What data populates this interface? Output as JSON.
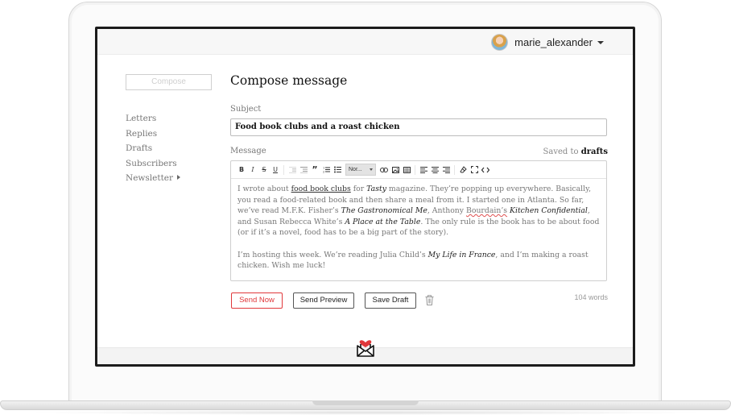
{
  "user": {
    "name": "marie_alexander",
    "avatar_icon": "user-avatar"
  },
  "sidebar": {
    "compose_label": "Compose",
    "items": [
      {
        "label": "Letters"
      },
      {
        "label": "Replies"
      },
      {
        "label": "Drafts"
      },
      {
        "label": "Subscribers"
      },
      {
        "label": "Newsletter",
        "has_submenu": true
      }
    ]
  },
  "main": {
    "title": "Compose message",
    "subject_label": "Subject",
    "subject_value": "Food book clubs and a roast chicken",
    "message_label": "Message",
    "saved_prefix": "Saved to",
    "saved_location": "drafts"
  },
  "toolbar": {
    "format_select": "Nor...",
    "buttons": [
      "bold-icon",
      "italic-icon",
      "strikethrough-icon",
      "underline-icon",
      "outdent-icon",
      "indent-icon",
      "blockquote-icon",
      "ordered-list-icon",
      "bullet-list-icon",
      "link-icon",
      "image-icon",
      "table-icon",
      "align-left-icon",
      "align-center-icon",
      "align-right-icon",
      "clear-format-icon",
      "fullscreen-icon",
      "code-view-icon"
    ]
  },
  "message": {
    "p1": {
      "t1": "I wrote about ",
      "link1": "food book clubs",
      "t2": " for ",
      "em1": "Tasty",
      "t3": " magazine. They’re popping up everywhere. Basically, you read a food-related book and then share a meal from it. I started one in Atlanta. So far, we’ve read M.F.K. Fisher’s ",
      "em2": "The Gastronomical Me",
      "t4": ", Anthony ",
      "spell1": "Bourdain’s",
      "t5": " ",
      "em3": "Kitchen Confidential",
      "t6": ", and Susan Rebecca White’s ",
      "em4": "A Place at the Table",
      "t7": ". The only rule is the book has to be about food (or if it’s a novel, food has to be a big part of the story)."
    },
    "p2": {
      "t1": "I’m hosting this week. We’re reading Julia Child’s ",
      "em1": "My Life in France",
      "t2": ", and I’m making a roast chicken. Wish me luck!"
    }
  },
  "actions": {
    "send_now": "Send Now",
    "send_preview": "Send Preview",
    "save_draft": "Save Draft",
    "word_count": "104 words"
  },
  "colors": {
    "accent": "#e0383b",
    "text": "#111111",
    "muted": "#777777"
  }
}
